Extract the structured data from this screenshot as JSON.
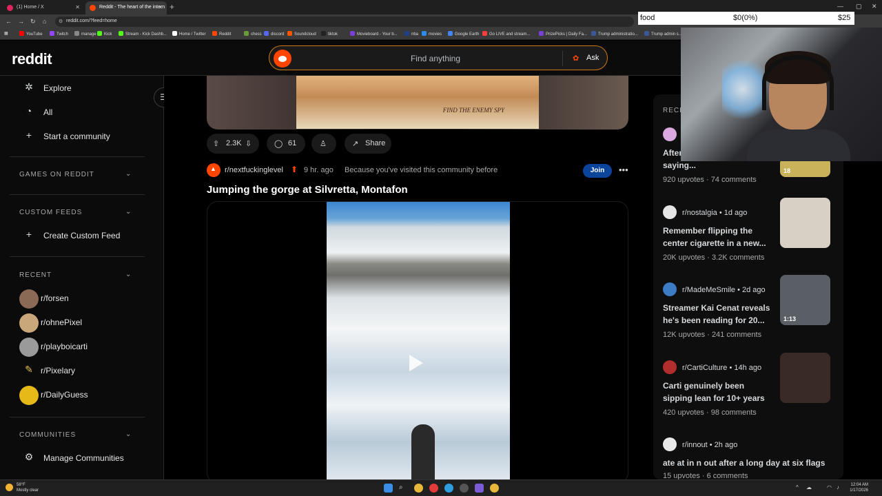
{
  "browser": {
    "tabs": [
      {
        "title": "(1) Home / X",
        "active": false,
        "icon_color": "#e0245e"
      },
      {
        "title": "Reddit - The heart of the intern",
        "active": true,
        "icon_color": "#ff4500"
      }
    ],
    "url": "reddit.com/?feed=home",
    "bookmarks": [
      "YouTube",
      "Twitch",
      "manage",
      "Kick",
      "Stream - Kick Dashb...",
      "Home / Twitter",
      "Reddit",
      "chess",
      "discord",
      "Soundcloud",
      "tiktok",
      "Movieboard - Your b...",
      "nba",
      "movies",
      "Google Earth",
      "Go LIVE and stream...",
      "PrizePicks | Daily Fa...",
      "Trump administratio...",
      "Trump admin s..."
    ]
  },
  "reddit": {
    "logo": "reddit",
    "search_placeholder": "Find anything",
    "ask_label": "Ask"
  },
  "sidebar": {
    "nav": [
      {
        "label": "Explore",
        "icon": "explore-icon",
        "glyph": "✲"
      },
      {
        "label": "All",
        "icon": "all-icon",
        "glyph": "◔"
      },
      {
        "label": "Start a community",
        "icon": "plus-icon",
        "glyph": "+"
      }
    ],
    "sections": {
      "games": "GAMES ON REDDIT",
      "custom_feeds": "CUSTOM FEEDS",
      "create_custom_feed": "Create Custom Feed",
      "recent": "RECENT",
      "communities": "COMMUNITIES",
      "manage_communities": "Manage Communities"
    },
    "recent": [
      {
        "name": "r/forsen",
        "color": "#8a6a55"
      },
      {
        "name": "r/ohnePixel",
        "color": "#c9a77a"
      },
      {
        "name": "r/playboicarti",
        "color": "#9a9a9a"
      },
      {
        "name": "r/Pixelary",
        "color": "#e5c04a"
      },
      {
        "name": "r/DailyGuess",
        "color": "#e6b818"
      }
    ]
  },
  "feed": {
    "top_post": {
      "image_caption": "FIND THE ENEMY SPY",
      "upvotes": "2.3K",
      "comments": "61",
      "share": "Share"
    },
    "post": {
      "subreddit": "r/nextfuckinglevel",
      "time": "9 hr. ago",
      "reason": "Because you've visited this community before",
      "join": "Join",
      "title": "Jumping the gorge at Silvretta, Montafon"
    }
  },
  "recent_posts": {
    "header": "RECENT POSTS",
    "items": [
      {
        "sub": "",
        "time": "",
        "title": "After 1000 hours, I'm saying...",
        "upvotes": "920 upvotes",
        "comments": "74 comments",
        "badge": "18",
        "avatar_color": "#d9a9e0",
        "thumb_color": "#c9b25a"
      },
      {
        "sub": "r/nostalgia",
        "time": "1d ago",
        "title": "Remember flipping the center cigarette in a new...",
        "upvotes": "20K upvotes",
        "comments": "3.2K comments",
        "badge": "",
        "avatar_color": "#e5e5e5",
        "thumb_color": "#d8d0c4"
      },
      {
        "sub": "r/MadeMeSmile",
        "time": "2d ago",
        "title": "Streamer Kai Cenat reveals he's been reading for 20...",
        "upvotes": "12K upvotes",
        "comments": "241 comments",
        "badge": "1:13",
        "avatar_color": "#3b7cc4",
        "thumb_color": "#5a5f66"
      },
      {
        "sub": "r/CartiCulture",
        "time": "14h ago",
        "title": "Carti genuinely been sipping lean for 10+ years",
        "upvotes": "420 upvotes",
        "comments": "98 comments",
        "badge": "",
        "avatar_color": "#b22d2d",
        "thumb_color": "#3a2a26"
      },
      {
        "sub": "r/innout",
        "time": "2h ago",
        "title": "ate at in n out after a long day at six flags",
        "upvotes": "15 upvotes",
        "comments": "6 comments",
        "badge": "",
        "avatar_color": "#e8e8e8",
        "thumb_color": ""
      }
    ]
  },
  "overlay": {
    "food_label": "food",
    "food_amount": "$0(0%)",
    "food_goal": "$25"
  },
  "taskbar": {
    "weather_temp": "58°F",
    "weather_desc": "Mostly clear",
    "time": "12:04 AM",
    "date": "1/17/2026"
  }
}
